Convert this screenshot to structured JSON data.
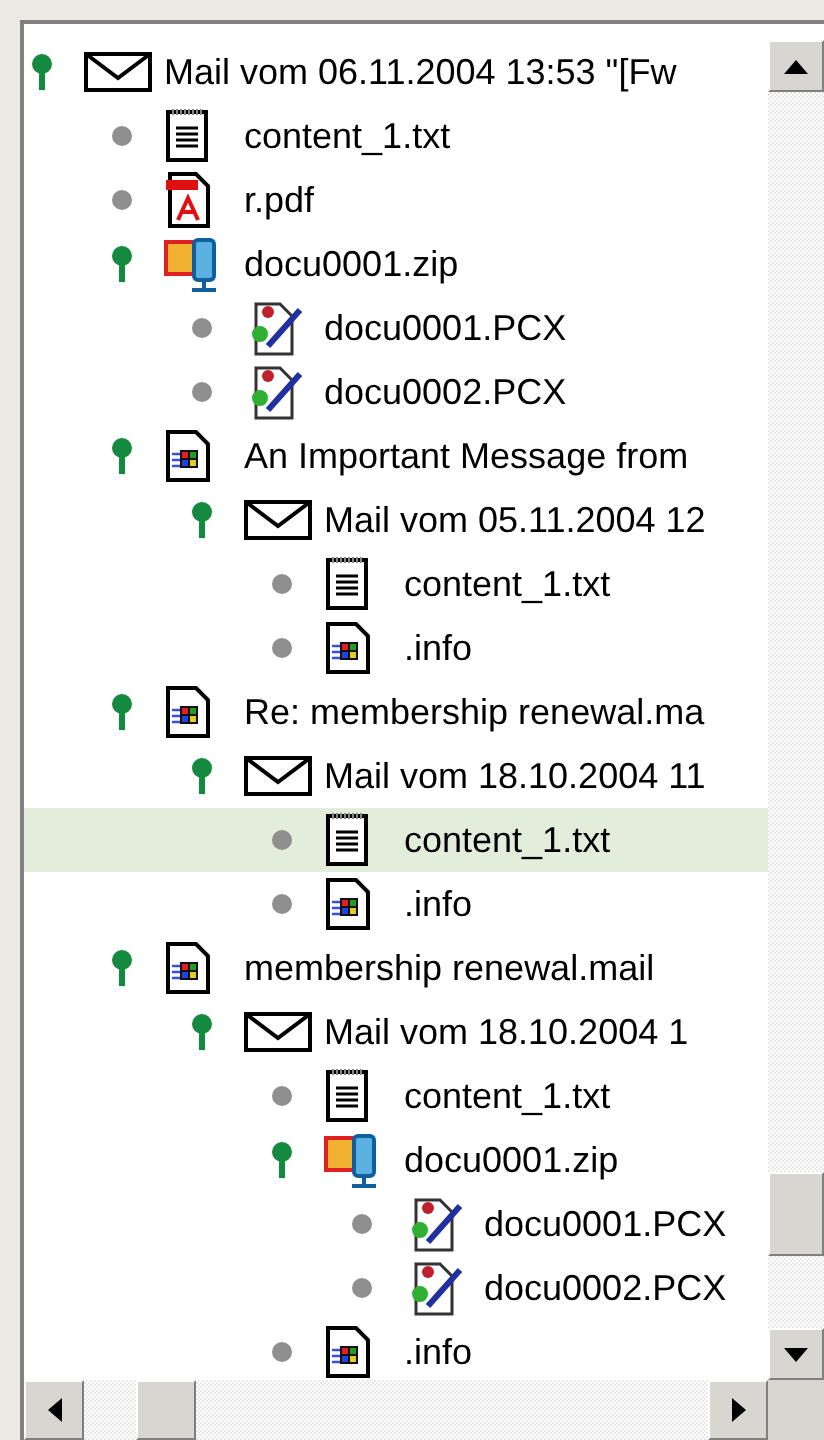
{
  "tree": [
    {
      "kind": "mail",
      "label": "Mail vom 06.11.2004 13:53 \"[Fw",
      "selected": false,
      "children": [
        {
          "kind": "txt",
          "label": "content_1.txt",
          "selected": false
        },
        {
          "kind": "pdf",
          "label": "r.pdf",
          "selected": false
        },
        {
          "kind": "zip",
          "label": "docu0001.zip",
          "selected": false,
          "children": [
            {
              "kind": "pcx",
              "label": "docu0001.PCX",
              "selected": false
            },
            {
              "kind": "pcx",
              "label": "docu0002.PCX",
              "selected": false
            }
          ]
        },
        {
          "kind": "msg",
          "label": "An Important Message from",
          "selected": false,
          "children": [
            {
              "kind": "mail",
              "label": "Mail vom 05.11.2004 12",
              "selected": false,
              "children": [
                {
                  "kind": "txt",
                  "label": "content_1.txt",
                  "selected": false
                },
                {
                  "kind": "msg",
                  "label": ".info",
                  "selected": false
                }
              ]
            }
          ]
        },
        {
          "kind": "msg",
          "label": "Re: membership renewal.ma",
          "selected": false,
          "children": [
            {
              "kind": "mail",
              "label": "Mail vom 18.10.2004 11",
              "selected": false,
              "children": [
                {
                  "kind": "txt",
                  "label": "content_1.txt",
                  "selected": true
                },
                {
                  "kind": "msg",
                  "label": ".info",
                  "selected": false
                }
              ]
            }
          ]
        },
        {
          "kind": "msg",
          "label": "membership renewal.mail",
          "selected": false,
          "children": [
            {
              "kind": "mail",
              "label": "Mail vom 18.10.2004 1",
              "selected": false,
              "children": [
                {
                  "kind": "txt",
                  "label": "content_1.txt",
                  "selected": false
                },
                {
                  "kind": "zip",
                  "label": "docu0001.zip",
                  "selected": false,
                  "children": [
                    {
                      "kind": "pcx",
                      "label": "docu0001.PCX",
                      "selected": false
                    },
                    {
                      "kind": "pcx",
                      "label": "docu0002.PCX",
                      "selected": false
                    }
                  ]
                },
                {
                  "kind": "msg",
                  "label": ".info",
                  "selected": false
                }
              ]
            }
          ]
        }
      ]
    }
  ]
}
